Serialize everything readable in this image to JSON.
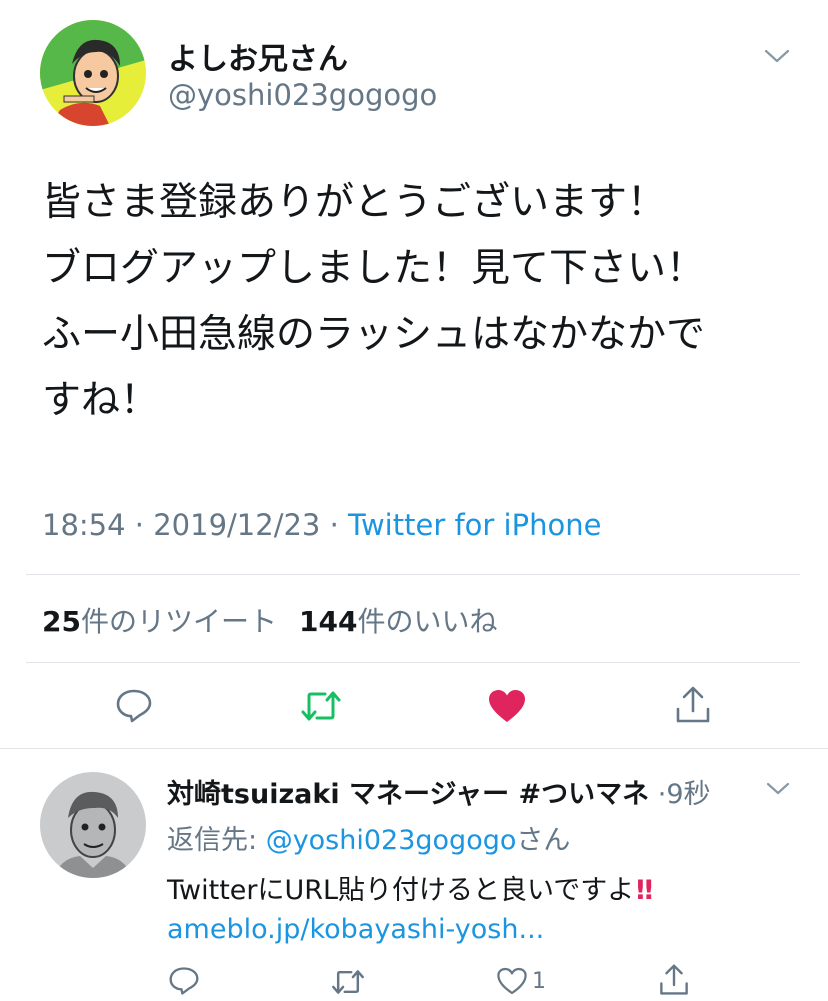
{
  "tweet": {
    "author_name": "よしお兄さん",
    "author_handle": "@yoshi023gogogo",
    "text_lines": [
      "皆さま登録ありがとうございます！",
      "ブログアップしました！見て下さい！",
      "ふー小田急線のラッシュはなかなかで",
      "すね！"
    ],
    "time": "18:54",
    "separator": " · ",
    "date": "2019/12/23",
    "source": "Twitter for iPhone",
    "retweet_count": "25",
    "retweet_label": "件のリツイート",
    "like_count": "144",
    "like_label": "件のいいね",
    "actions": [
      "reply-icon",
      "retweet-icon",
      "like-icon",
      "share-icon"
    ],
    "colors": {
      "retweet_active": "#17bf63",
      "like_active": "#e0245e",
      "link": "#1b95e0",
      "muted": "#657786"
    }
  },
  "reply": {
    "author_name": "対崎tsuizaki マネージャー #ついマネ",
    "separator": "·",
    "time": "9秒",
    "replying_prefix": "返信先: ",
    "replying_handle": "@yoshi023gogogo",
    "replying_suffix": "さん",
    "text": "TwitterにURL貼り付けると良いですよ",
    "emphasis": "!!",
    "link": "ameblo.jp/kobayashi-yosh...",
    "like_count": "1",
    "actions": [
      "reply-icon",
      "retweet-icon",
      "like-icon",
      "share-icon"
    ]
  }
}
